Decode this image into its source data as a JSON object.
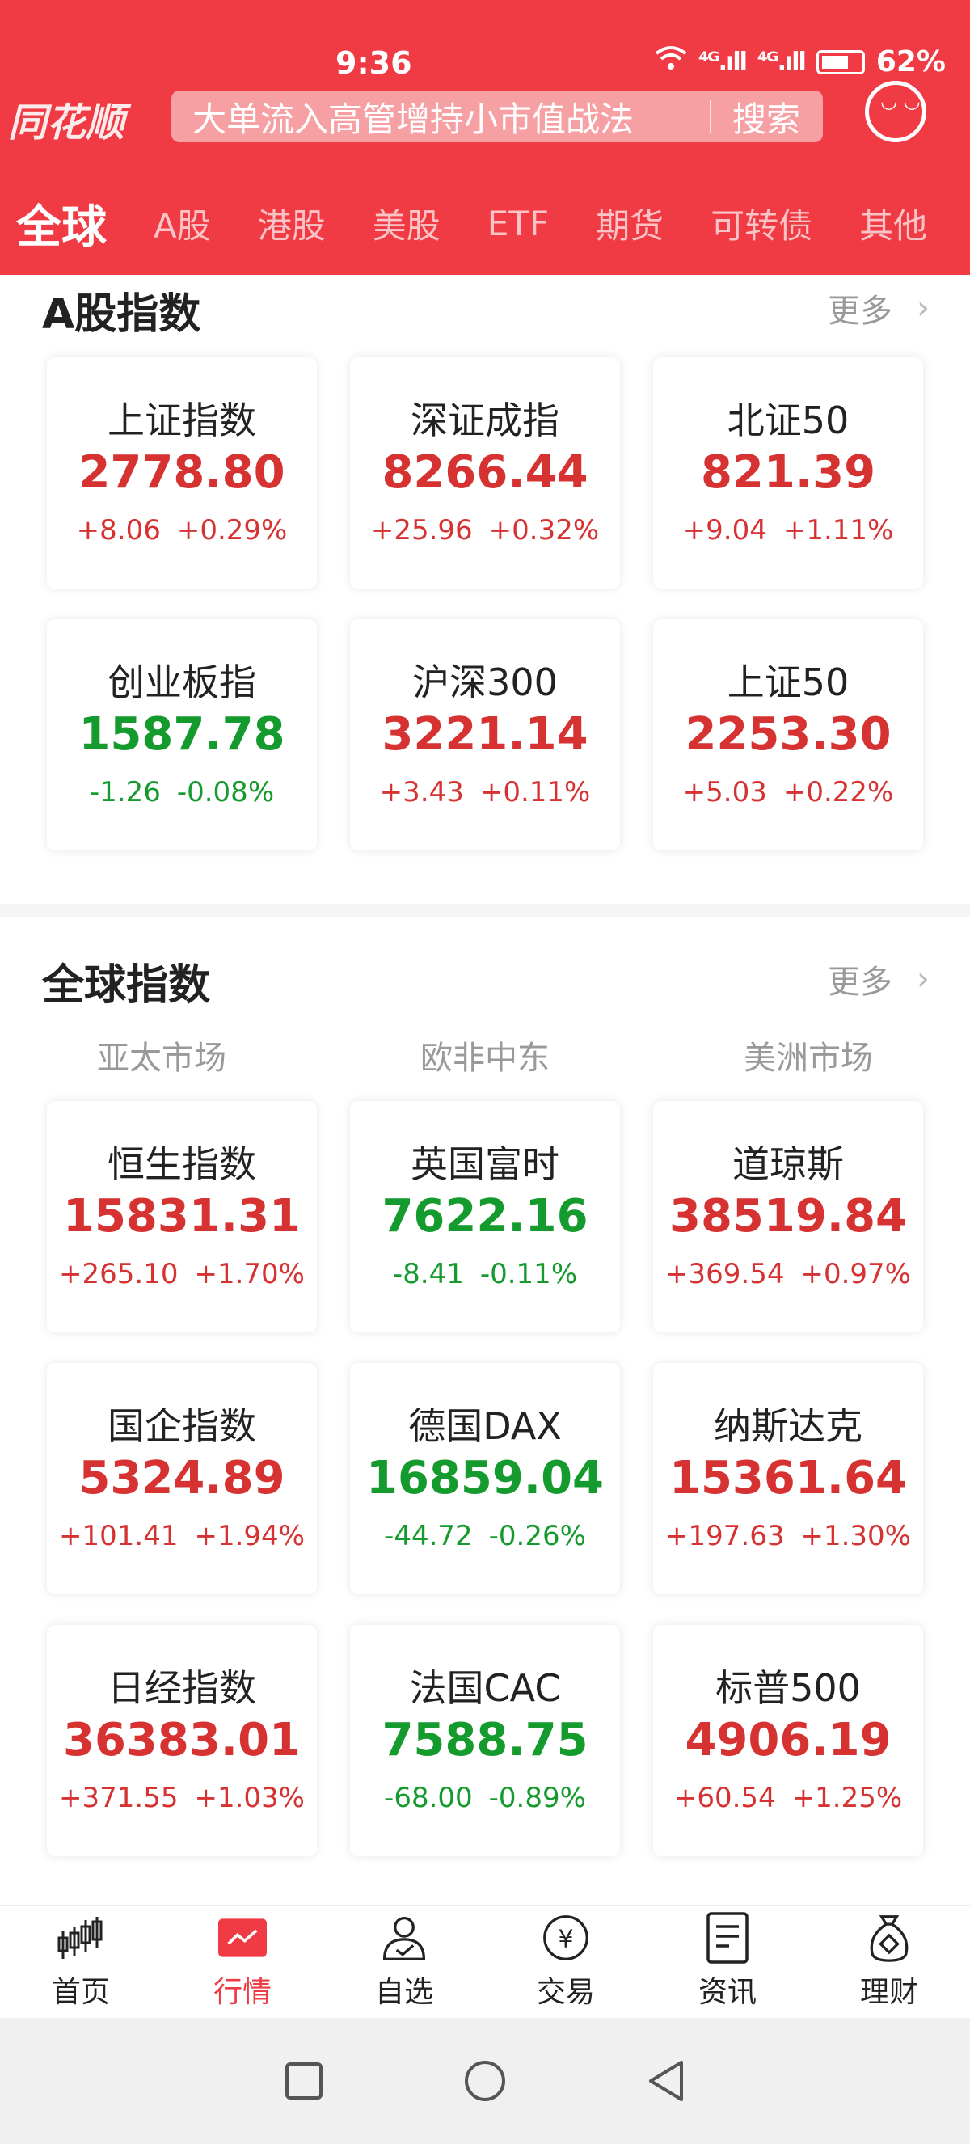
{
  "status_bar": {
    "time": "9:36",
    "signal1": "⁴ᴳ.ıll",
    "signal2": "⁴ᴳ.ıll",
    "battery": "62%"
  },
  "header": {
    "logo": "同花顺",
    "search_text": "大单流入高管增持小市值战法",
    "search_button": "搜索",
    "tabs": [
      "全球",
      "A股",
      "港股",
      "美股",
      "ETF",
      "期货",
      "可转债",
      "其他"
    ]
  },
  "a_share": {
    "title": "A股指数",
    "more": "更多",
    "cards": [
      {
        "name": "上证指数",
        "value": "2778.80",
        "change": "+8.06",
        "pct": "+0.29%",
        "dir": "up"
      },
      {
        "name": "深证成指",
        "value": "8266.44",
        "change": "+25.96",
        "pct": "+0.32%",
        "dir": "up"
      },
      {
        "name": "北证50",
        "value": "821.39",
        "change": "+9.04",
        "pct": "+1.11%",
        "dir": "up"
      },
      {
        "name": "创业板指",
        "value": "1587.78",
        "change": "-1.26",
        "pct": "-0.08%",
        "dir": "down"
      },
      {
        "name": "沪深300",
        "value": "3221.14",
        "change": "+3.43",
        "pct": "+0.11%",
        "dir": "up"
      },
      {
        "name": "上证50",
        "value": "2253.30",
        "change": "+5.03",
        "pct": "+0.22%",
        "dir": "up"
      }
    ]
  },
  "global": {
    "title": "全球指数",
    "more": "更多",
    "markets": [
      "亚太市场",
      "欧非中东",
      "美洲市场"
    ],
    "cards": [
      {
        "name": "恒生指数",
        "value": "15831.31",
        "change": "+265.10",
        "pct": "+1.70%",
        "dir": "up"
      },
      {
        "name": "英国富时",
        "value": "7622.16",
        "change": "-8.41",
        "pct": "-0.11%",
        "dir": "down"
      },
      {
        "name": "道琼斯",
        "value": "38519.84",
        "change": "+369.54",
        "pct": "+0.97%",
        "dir": "up"
      },
      {
        "name": "国企指数",
        "value": "5324.89",
        "change": "+101.41",
        "pct": "+1.94%",
        "dir": "up"
      },
      {
        "name": "德国DAX",
        "value": "16859.04",
        "change": "-44.72",
        "pct": "-0.26%",
        "dir": "down"
      },
      {
        "name": "纳斯达克",
        "value": "15361.64",
        "change": "+197.63",
        "pct": "+1.30%",
        "dir": "up"
      },
      {
        "name": "日经指数",
        "value": "36383.01",
        "change": "+371.55",
        "pct": "+1.03%",
        "dir": "up"
      },
      {
        "name": "法国CAC",
        "value": "7588.75",
        "change": "-68.00",
        "pct": "-0.89%",
        "dir": "down"
      },
      {
        "name": "标普500",
        "value": "4906.19",
        "change": "+60.54",
        "pct": "+1.25%",
        "dir": "up"
      }
    ]
  },
  "bottom_nav": [
    {
      "label": "首页",
      "icon": "candlestick-icon"
    },
    {
      "label": "行情",
      "icon": "chart-icon",
      "active": true
    },
    {
      "label": "自选",
      "icon": "user-check-icon"
    },
    {
      "label": "交易",
      "icon": "yen-icon"
    },
    {
      "label": "资讯",
      "icon": "document-icon"
    },
    {
      "label": "理财",
      "icon": "money-bag-icon"
    }
  ],
  "colors": {
    "brand": "#f03a44",
    "up": "#d63232",
    "down": "#159a2d"
  }
}
